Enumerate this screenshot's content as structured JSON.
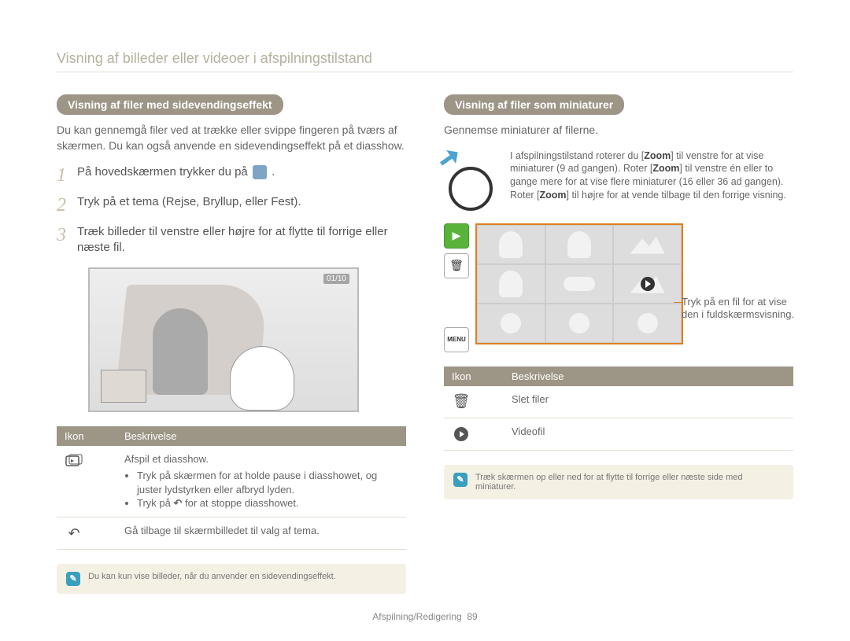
{
  "breadcrumb": "Visning af billeder eller videoer i afspilningstilstand",
  "left": {
    "section_title": "Visning af filer med sidevendingseffekt",
    "intro": "Du kan gennemgå filer ved at trække eller svippe fingeren på tværs af skærmen. Du kan også anvende en sidevendingseffekt på et diasshow.",
    "steps": {
      "s1_pre": "På hovedskærmen trykker du på ",
      "s1_post": " .",
      "s2": "Tryk på et tema (Rejse, Bryllup, eller Fest).",
      "s3": "Træk billeder til venstre eller højre for at flytte til forrige eller næste fil."
    },
    "figure_counter": "01/10",
    "table": {
      "h1": "Ikon",
      "h2": "Beskrivelse",
      "row1_main": "Afspil et diasshow.",
      "row1_b1": "Tryk på skærmen for at holde pause i diasshowet, og juster lydstyrken eller afbryd lyden.",
      "row1_b2_pre": "Tryk på ",
      "row1_b2_post": " for at stoppe diasshowet.",
      "row2": "Gå tilbage til skærmbilledet til valg af tema."
    },
    "note": "Du kan kun vise billeder, når du anvender en sidevendingseffekt."
  },
  "right": {
    "section_title": "Visning af filer som miniaturer",
    "intro": "Gennemse miniaturer af filerne.",
    "zoom_text_a": "I afspilningstilstand roterer du [",
    "zoom_kw": "Zoom",
    "zoom_text_b": "] til venstre for at vise miniaturer (9 ad gangen). Roter [",
    "zoom_text_c": "] til venstre én eller to gange mere for at vise flere miniaturer (16 eller 36 ad gangen). Roter [",
    "zoom_text_d": "] til højre for at vende tilbage til den forrige visning.",
    "menu_label": "MENU",
    "leader": "Tryk på en fil for at vise den i fuldskærmsvisning.",
    "table": {
      "h1": "Ikon",
      "h2": "Beskrivelse",
      "row1": "Slet filer",
      "row2": "Videofil"
    },
    "note": "Træk skærmen op eller ned for at flytte til forrige eller næste side med miniaturer."
  },
  "footer": {
    "section": "Afspilning/Redigering",
    "page": "89"
  }
}
